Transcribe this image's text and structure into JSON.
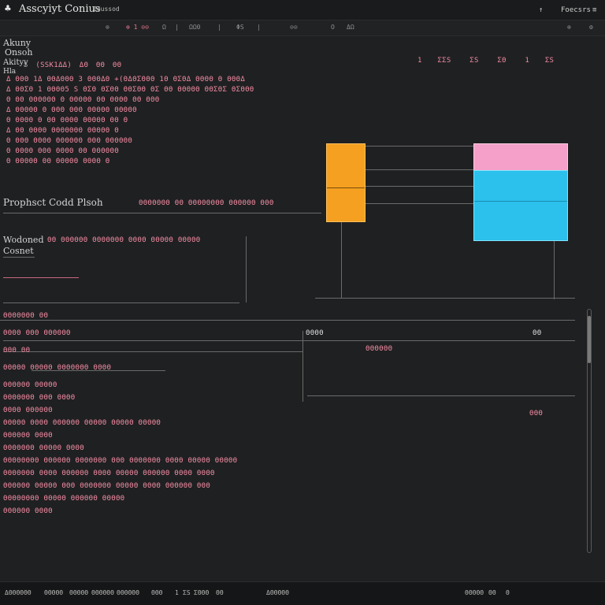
{
  "window": {
    "title": "Asscyiyt Conius",
    "badge": "Ioussod",
    "controls": [
      "↑",
      "Foecsrs",
      "≡"
    ]
  },
  "toolbar": {
    "items": [
      "⊗",
      "⊕ 1 ⊙⊙",
      "Ω",
      "|",
      "ΩΩ0",
      "|",
      "ΦS",
      "|",
      "⊙⊙",
      "O",
      "ΔΩ"
    ],
    "right": [
      "⊕",
      "⚙"
    ]
  },
  "sidebar_labels": {
    "label1": "Akuny",
    "label2": "Onsoh",
    "label3": "Akityy",
    "label4": "Hla",
    "section_code": "Prophsct Codd Plsoh",
    "section_ctx_a": "Wodoned",
    "section_ctx_b": "Cosnet"
  },
  "header_row": {
    "left": [
      "S",
      "(SSK1ΔΔ)",
      "ΔΘ",
      "ΘΘ",
      "ΘΘ"
    ],
    "right": [
      "1 ΣΣS",
      "ΣS",
      "ΣΘ",
      "1 ΣS"
    ]
  },
  "code_rows": [
    "Δ ΘΘΘ 1Δ  ΘΘΔΘΘΘ 3  ΘΘΘΔΘ +(ΘΔΘΣΘΘΘ 1Θ  ΘΣΘΔ ΘΘΘΘ Θ  ΘΘΘΔ",
    "Δ ΘΘΣΘ 1 ΘΘΘΘ5 S  ΘΣΘ  ΘΣΘΘ ΘΘΣΘΘ  ΘΣ ΘΘ  ΘΘΘΘΘ  ΘΘΣΘΣ  ΘΣΘΘΘ",
    "Θ  ΘΘ  ΘΘΘΘΘΘ  Θ  ΘΘΘΘΘ  ΘΘ  ΘΘΘΘ  ΘΘ  ΘΘΘ",
    "Δ ΘΘΘΘΘ  Θ  ΘΘΘ  ΘΘΘ  ΘΘΘΘΘ  ΘΘΘΘΘ",
    "Θ ΘΘΘΘ  Θ  ΘΘ  ΘΘΘΘ  ΘΘΘΘΘ  ΘΘ  Θ",
    "Δ ΘΘ  ΘΘΘΘ  ΘΘΘΘΘΘΘ  ΘΘΘΘΘ  Θ",
    "Θ ΘΘΘ  ΘΘΘΘ  ΘΘΘΘΘΘ  ΘΘΘ  ΘΘΘΘΘΘ",
    "Θ ΘΘΘΘ  ΘΘΘ  ΘΘΘΘ  ΘΘ  ΘΘΘΘΘΘ",
    "Θ ΘΘΘΘΘ  ΘΘ  ΘΘΘΘΘ  ΘΘΘΘ  Θ"
  ],
  "plan_row": "ΘΘΘΘΘΘΘ  ΘΘ  ΘΘΘΘΘΘΘΘ ΘΘΘΘΘΘ  ΘΘΘ",
  "context_row": "ΘΘ  ΘΘΘΘΘΘ  ΘΘΘΘΘΘΘ  ΘΘΘΘ  ΘΘΘΘΘ  ΘΘΘΘΘ",
  "lower_rows": [
    "ΘΘΘΘΘΘΘ  ΘΘ",
    "ΘΘΘΘ  ΘΘΘ  ΘΘΘΘΘΘ",
    "ΘΘΘ  ΘΘ",
    "ΘΘΘΘΘ  ΘΘΘΘΘ  ΘΘΘΘΘΘΘ  ΘΘΘΘ",
    "ΘΘΘΘΘΘ  ΘΘΘΘΘ",
    "ΘΘΘΘΘΘΘ  ΘΘΘ  ΘΘΘΘ",
    "ΘΘΘΘ  ΘΘΘΘΘΘ",
    "ΘΘΘΘΘ  ΘΘΘΘ  ΘΘΘΘΘΘ  ΘΘΘΘΘ  ΘΘΘΘΘ  ΘΘΘΘΘ",
    "ΘΘΘΘΘΘ  ΘΘΘΘ",
    "ΘΘΘΘΘΘΘ  ΘΘΘΘΘ  ΘΘΘΘ",
    "ΘΘΘΘΘΘΘΘ  ΘΘΘΘΘΘ  ΘΘΘΘΘΘΘ  ΘΘΘ  ΘΘΘΘΘΘΘ  ΘΘΘΘ  ΘΘΘΘΘ  ΘΘΘΘΘ",
    "ΘΘΘΘΘΘΘ  ΘΘΘΘ  ΘΘΘΘΘΘ  ΘΘΘΘ  ΘΘΘΘΘ  ΘΘΘΘΘΘ  ΘΘΘΘ  ΘΘΘΘ",
    "ΘΘΘΘΘΘ  ΘΘΘΘΘ  ΘΘΘ  ΘΘΘΘΘΘΘ  ΘΘΘΘΘ  ΘΘΘΘ  ΘΘΘΘΘΘ  ΘΘΘ",
    "ΘΘΘΘΘΘΘΘ  ΘΘΘΘΘ  ΘΘΘΘΘΘ  ΘΘΘΘΘ",
    "ΘΘΘΘΘΘ  ΘΘΘΘ"
  ],
  "right_labels": [
    "ΘΘΘΘ",
    "ΘΘΘΘΘΘ",
    "ΘΘ",
    "ΘΘΘ"
  ],
  "status": {
    "items": [
      "ΔΘΘΘΘΘΘ",
      "ΘΘΘΘΘ",
      "ΘΘΘΘΘ",
      "ΘΘΘΘΘΘ",
      "ΘΘΘΘΘΘ",
      "ΘΘΘ",
      "1",
      "ΣS",
      "ΣΘΘΘ",
      "ΘΘ",
      "ΔΘΘΘΘΘ"
    ],
    "right": [
      "ΘΘΘΘΘ",
      "ΘΘ",
      "Θ"
    ]
  },
  "colors": {
    "background": "#1f2022",
    "accent_pink": "#f08aa0",
    "orange_block": "#f5a020",
    "cube_top": "#f4a0c8",
    "cube_body": "#2cc0ec"
  }
}
